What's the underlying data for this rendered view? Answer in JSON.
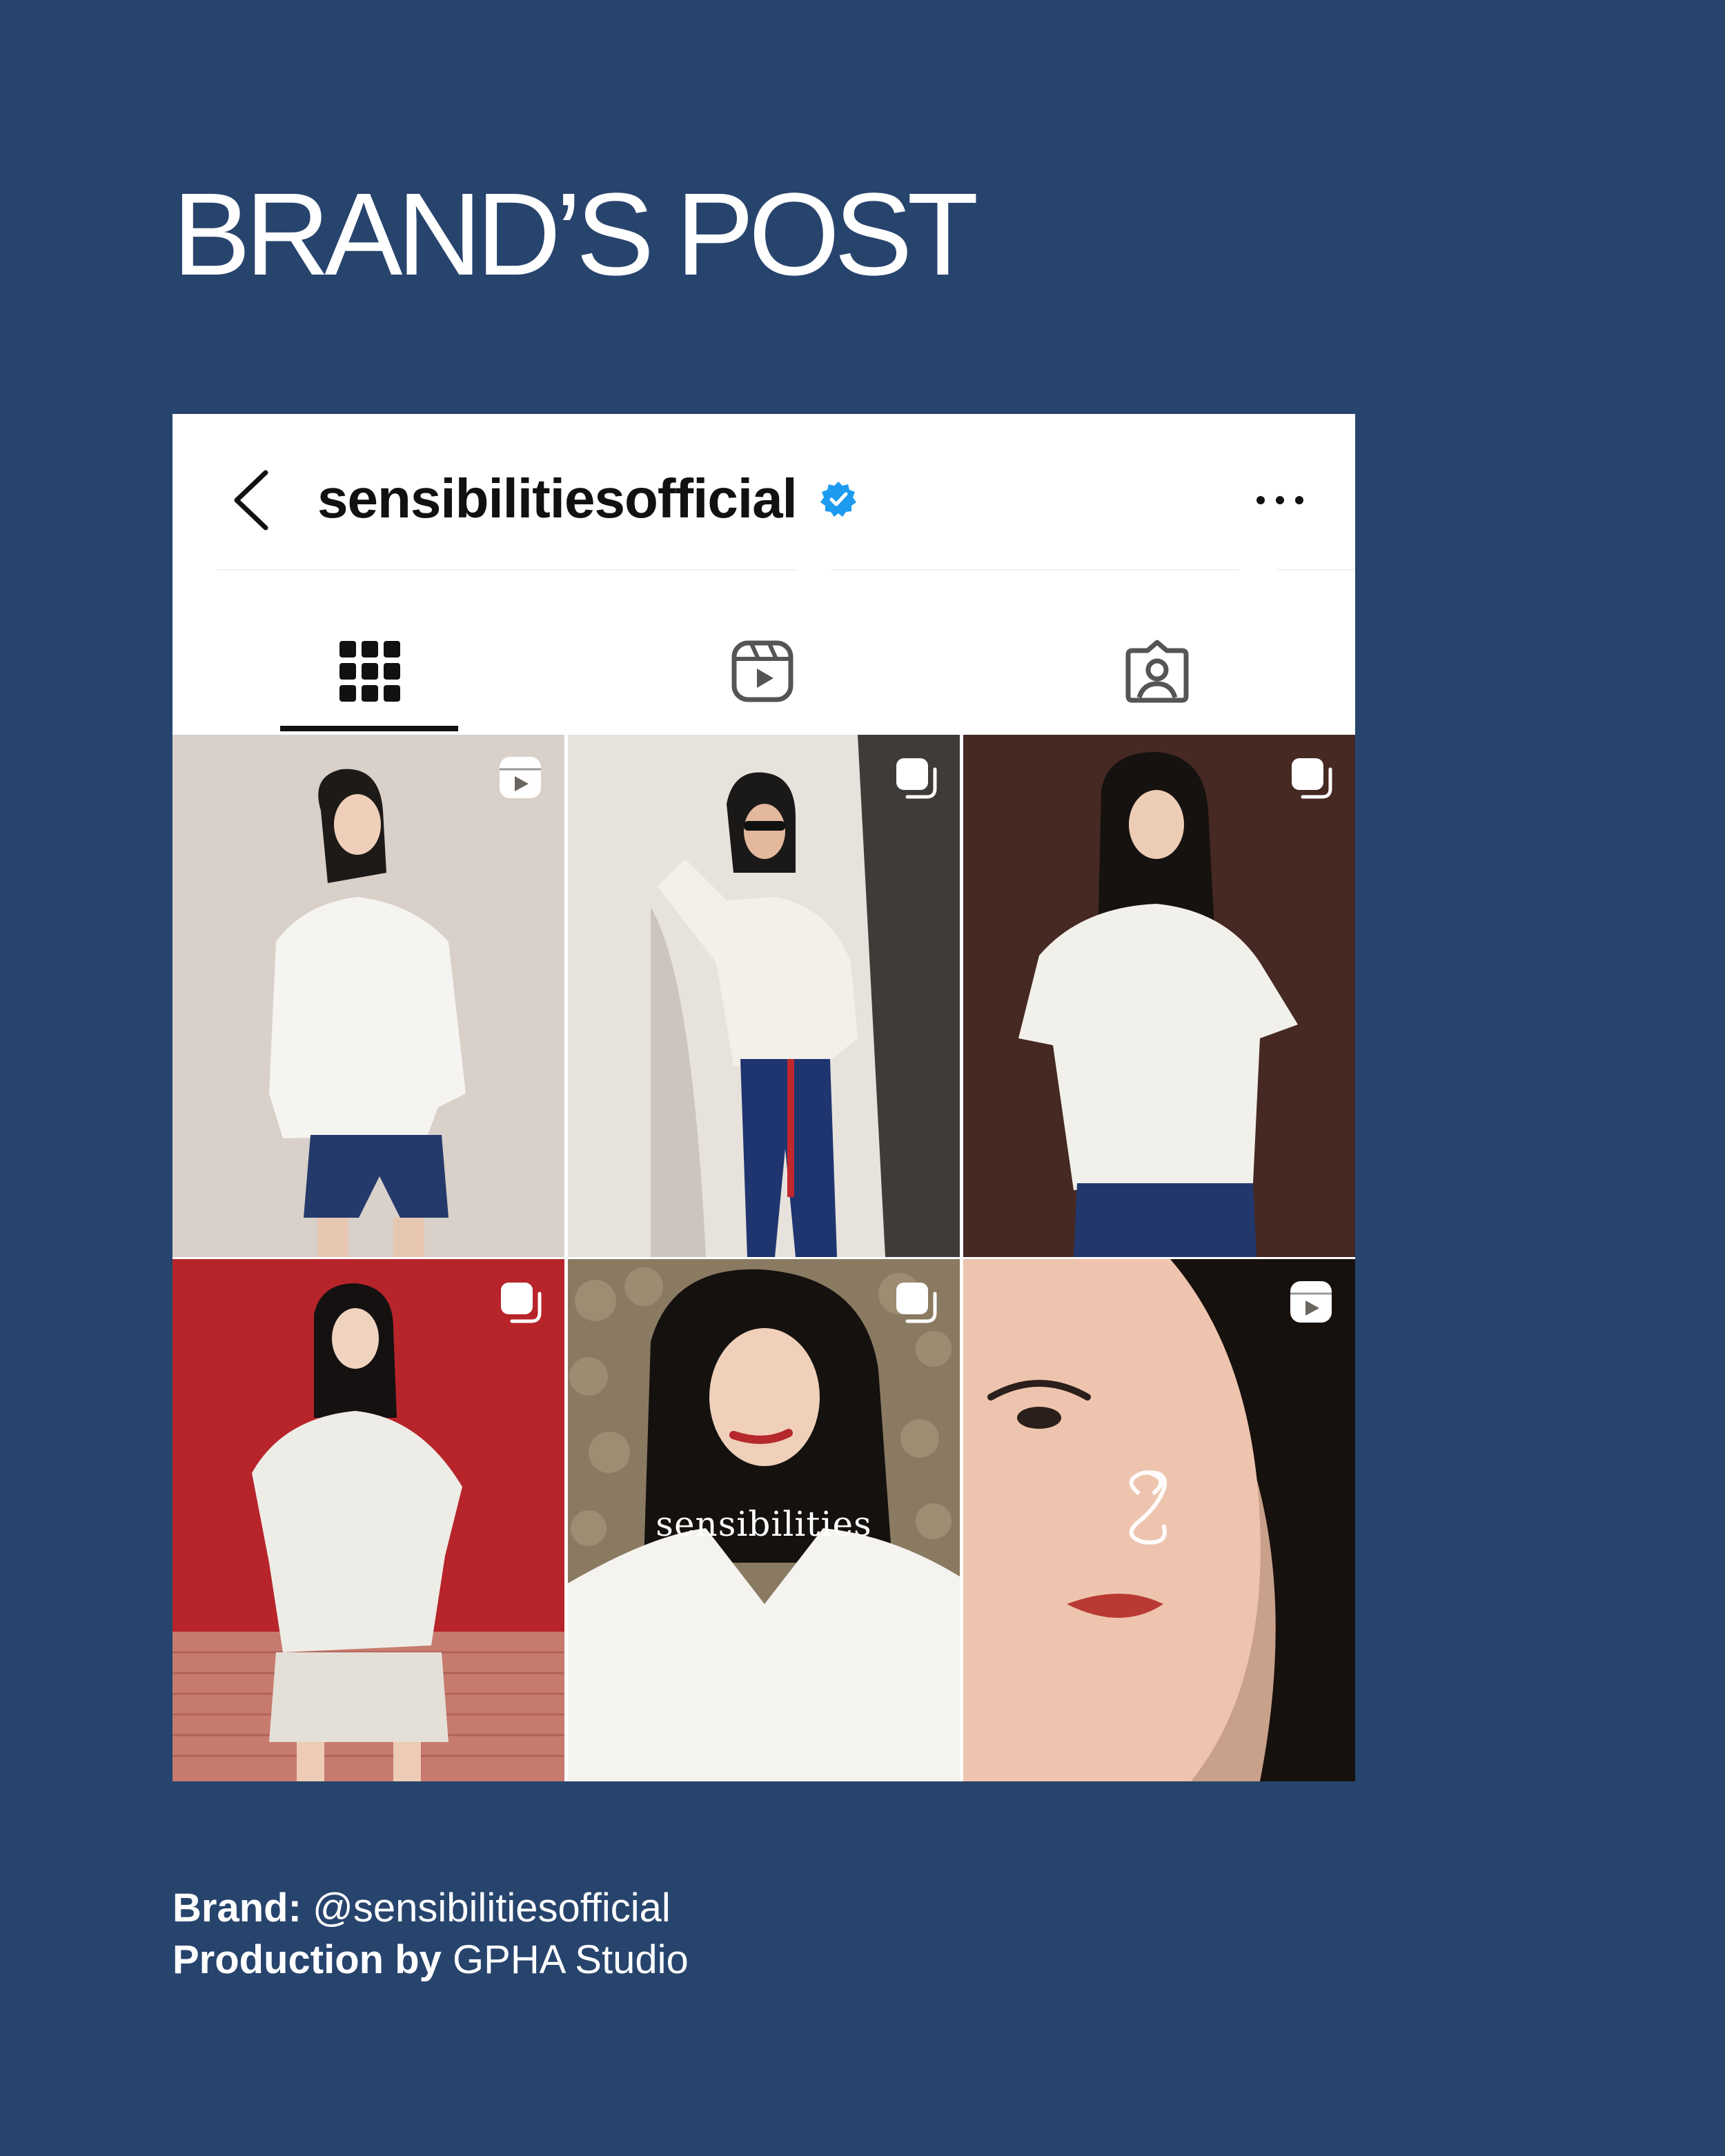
{
  "page": {
    "title": "BRAND’S POST"
  },
  "profile": {
    "username": "sensibilitiesofficial",
    "verified": true,
    "tabs": [
      {
        "name": "posts",
        "icon": "grid-icon",
        "active": true
      },
      {
        "name": "reels",
        "icon": "reels-icon",
        "active": false
      },
      {
        "name": "tagged",
        "icon": "tagged-icon",
        "active": false
      }
    ]
  },
  "grid": {
    "tiles": [
      {
        "type": "reel",
        "badge_icon": "reels-icon",
        "backdrop": "#ddd6cf",
        "overlay_text": ""
      },
      {
        "type": "carousel",
        "badge_icon": "carousel-icon",
        "backdrop": "#e7e2dc",
        "overlay_text": ""
      },
      {
        "type": "carousel",
        "badge_icon": "carousel-icon",
        "backdrop": "#3b2420",
        "overlay_text": ""
      },
      {
        "type": "carousel",
        "badge_icon": "carousel-icon",
        "backdrop": "#b7242a",
        "overlay_text": ""
      },
      {
        "type": "carousel",
        "badge_icon": "carousel-icon",
        "backdrop": "#8a7a62",
        "overlay_text": "sensibilities"
      },
      {
        "type": "reel",
        "badge_icon": "reels-icon",
        "backdrop": "#c9a08a",
        "overlay_text": ""
      }
    ]
  },
  "footer": {
    "brand_label": "Brand:",
    "brand_value": "@sensibilitiesofficial",
    "production_label": "Production by",
    "production_value": "GPHA Studio"
  },
  "colors": {
    "background": "#27446d",
    "verified": "#1d9bf0",
    "card": "#ffffff"
  }
}
